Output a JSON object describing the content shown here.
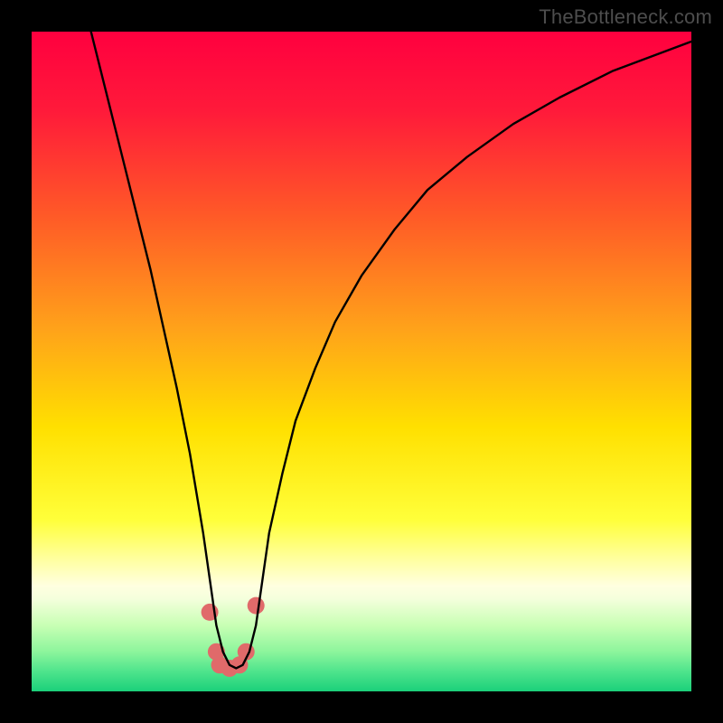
{
  "watermark": "TheBottleneck.com",
  "chart_data": {
    "type": "line",
    "title": "",
    "xlabel": "",
    "ylabel": "",
    "xlim": [
      0,
      100
    ],
    "ylim": [
      0,
      100
    ],
    "background": {
      "type": "vertical-gradient",
      "stops": [
        {
          "offset": 0.0,
          "color": "#ff003f"
        },
        {
          "offset": 0.12,
          "color": "#ff1a3a"
        },
        {
          "offset": 0.28,
          "color": "#ff5a27"
        },
        {
          "offset": 0.45,
          "color": "#ffa21a"
        },
        {
          "offset": 0.6,
          "color": "#ffe000"
        },
        {
          "offset": 0.74,
          "color": "#ffff3a"
        },
        {
          "offset": 0.8,
          "color": "#ffffa0"
        },
        {
          "offset": 0.84,
          "color": "#ffffe0"
        },
        {
          "offset": 0.86,
          "color": "#f4ffdc"
        },
        {
          "offset": 0.9,
          "color": "#c8ffb4"
        },
        {
          "offset": 0.94,
          "color": "#8cf59c"
        },
        {
          "offset": 0.97,
          "color": "#4ee48c"
        },
        {
          "offset": 1.0,
          "color": "#1bd07a"
        }
      ]
    },
    "series": [
      {
        "name": "bottleneck-curve",
        "stroke": "#000000",
        "x": [
          9,
          10,
          12,
          14,
          16,
          18,
          20,
          22,
          24,
          25,
          26,
          27,
          28,
          29,
          30,
          31,
          32,
          33,
          34,
          35,
          36,
          38,
          40,
          43,
          46,
          50,
          55,
          60,
          66,
          73,
          80,
          88,
          96,
          100
        ],
        "y": [
          100,
          96,
          88,
          80,
          72,
          64,
          55,
          46,
          36,
          30,
          24,
          17,
          10,
          6,
          4,
          3.5,
          4,
          6,
          10,
          17,
          24,
          33,
          41,
          49,
          56,
          63,
          70,
          76,
          81,
          86,
          90,
          94,
          97,
          98.5
        ]
      }
    ],
    "markers": {
      "color": "#e06a6a",
      "radius_pct": 1.3,
      "points": [
        {
          "x": 27.0,
          "y": 12
        },
        {
          "x": 28.0,
          "y": 6
        },
        {
          "x": 28.5,
          "y": 4
        },
        {
          "x": 30.0,
          "y": 3.5
        },
        {
          "x": 31.5,
          "y": 4
        },
        {
          "x": 32.5,
          "y": 6
        },
        {
          "x": 34.0,
          "y": 13
        }
      ]
    }
  }
}
